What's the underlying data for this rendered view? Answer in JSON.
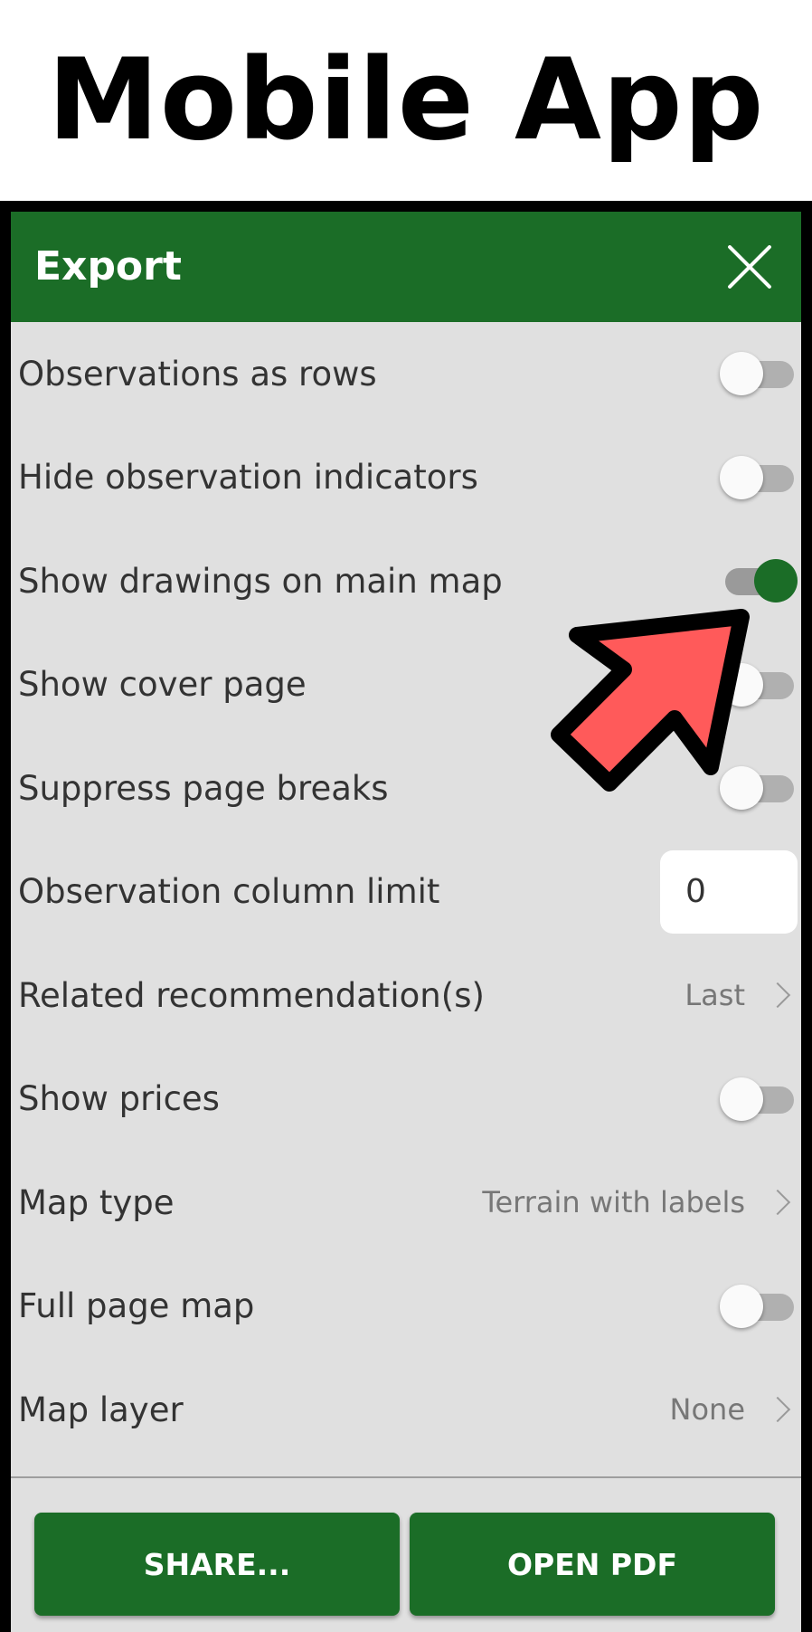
{
  "headline": "Mobile App",
  "dialog": {
    "title": "Export",
    "close_icon": "close-icon"
  },
  "settings": [
    {
      "label": "Observations as rows",
      "control": "toggle",
      "on": false
    },
    {
      "label": "Hide observation indicators",
      "control": "toggle",
      "on": false
    },
    {
      "label": "Show drawings on main map",
      "control": "toggle",
      "on": true
    },
    {
      "label": "Show cover page",
      "control": "toggle",
      "on": false
    },
    {
      "label": "Suppress page breaks",
      "control": "toggle",
      "on": false
    },
    {
      "label": "Observation column limit",
      "control": "number",
      "value": "0"
    },
    {
      "label": "Related recommendation(s)",
      "control": "select",
      "value": "Last"
    },
    {
      "label": "Show prices",
      "control": "toggle",
      "on": false
    },
    {
      "label": "Map type",
      "control": "select",
      "value": "Terrain with labels"
    },
    {
      "label": "Full page map",
      "control": "toggle",
      "on": false
    },
    {
      "label": "Map layer",
      "control": "select",
      "value": "None"
    }
  ],
  "buttons": {
    "share": "SHARE...",
    "open_pdf": "OPEN PDF"
  },
  "colors": {
    "accent": "#1b6d27",
    "panel_background": "#e0e0e0",
    "arrow_fill": "#ff5a5a"
  },
  "annotation_icon": "pointer-arrow-icon"
}
